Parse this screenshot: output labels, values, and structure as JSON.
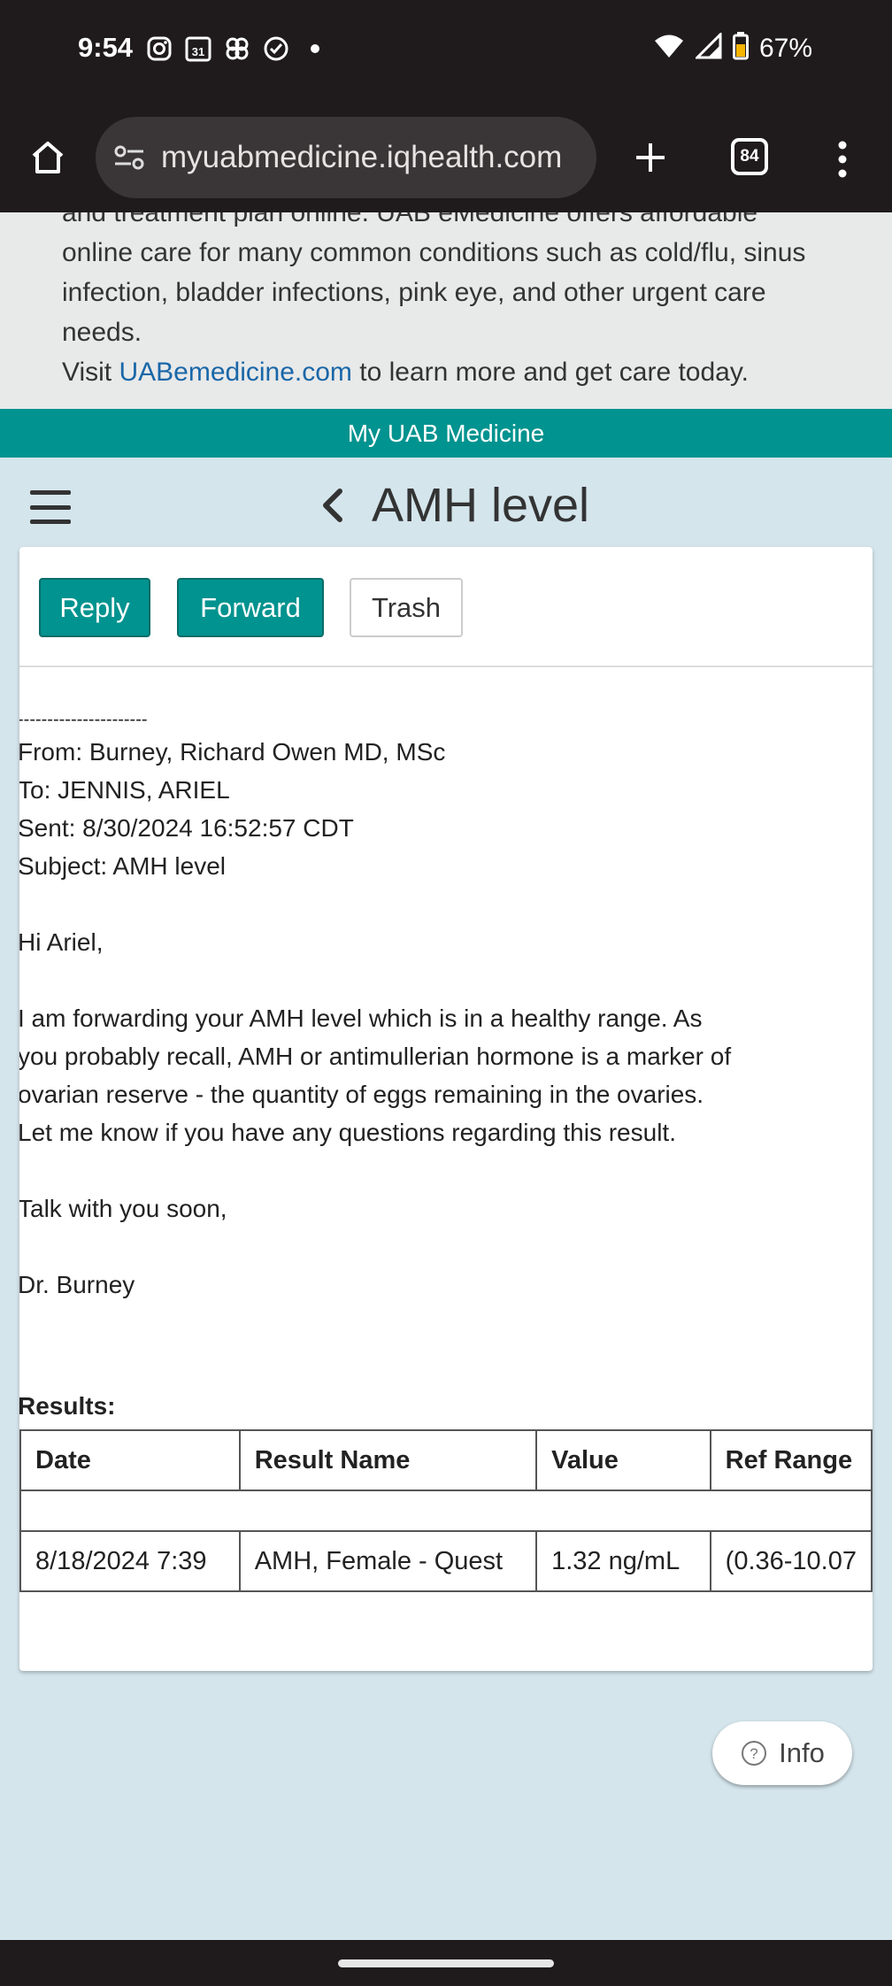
{
  "status_bar": {
    "time": "9:54",
    "notification_icons": [
      "instagram-icon",
      "calendar-31-icon",
      "pinwheel-icon",
      "check-circle-icon",
      "dot-icon"
    ],
    "calendar_day": "31",
    "battery_percent": "67%"
  },
  "browser": {
    "url": "myuabmedicine.iqhealth.com",
    "tab_count": "84"
  },
  "banner": {
    "line_cut": "and treatment plan online. UAB eMedicine offers affordable",
    "body": "online care for many common conditions such as cold/flu, sinus infection, bladder infections, pink eye, and other urgent care needs.",
    "visit_prefix": "Visit",
    "link_text": "UABemedicine.com",
    "visit_suffix": "to learn more and get care today."
  },
  "brand_bar": {
    "title": "My UAB Medicine"
  },
  "header": {
    "title": "AMH level"
  },
  "actions": {
    "reply": "Reply",
    "forward": "Forward",
    "trash": "Trash"
  },
  "message": {
    "separator": "----------------------",
    "from": "From: Burney, Richard Owen MD, MSc",
    "to": "To: JENNIS, ARIEL",
    "sent": "Sent: 8/30/2024 16:52:57 CDT",
    "subject": "Subject: AMH level",
    "greeting": "Hi Ariel,",
    "body_lines": [
      "I am forwarding your AMH level which is in a healthy range. As",
      "you probably recall, AMH or antimullerian hormone is a marker of",
      "ovarian reserve - the quantity of eggs remaining in the ovaries.",
      "Let me know if you have any questions regarding this result."
    ],
    "closing": "Talk with you soon,",
    "signature": "Dr. Burney"
  },
  "results": {
    "label": "Results:",
    "columns": [
      "Date",
      "Result Name",
      "Value",
      "Ref Range"
    ],
    "rows": [
      [
        "8/18/2024 7:39",
        "AMH, Female - Quest",
        "1.32 ng/mL",
        "(0.36-10.07"
      ]
    ]
  },
  "info_button": {
    "label": "Info"
  },
  "colors": {
    "teal": "#00938f",
    "link": "#1a67a8",
    "page_bg": "#d4e5ec"
  }
}
